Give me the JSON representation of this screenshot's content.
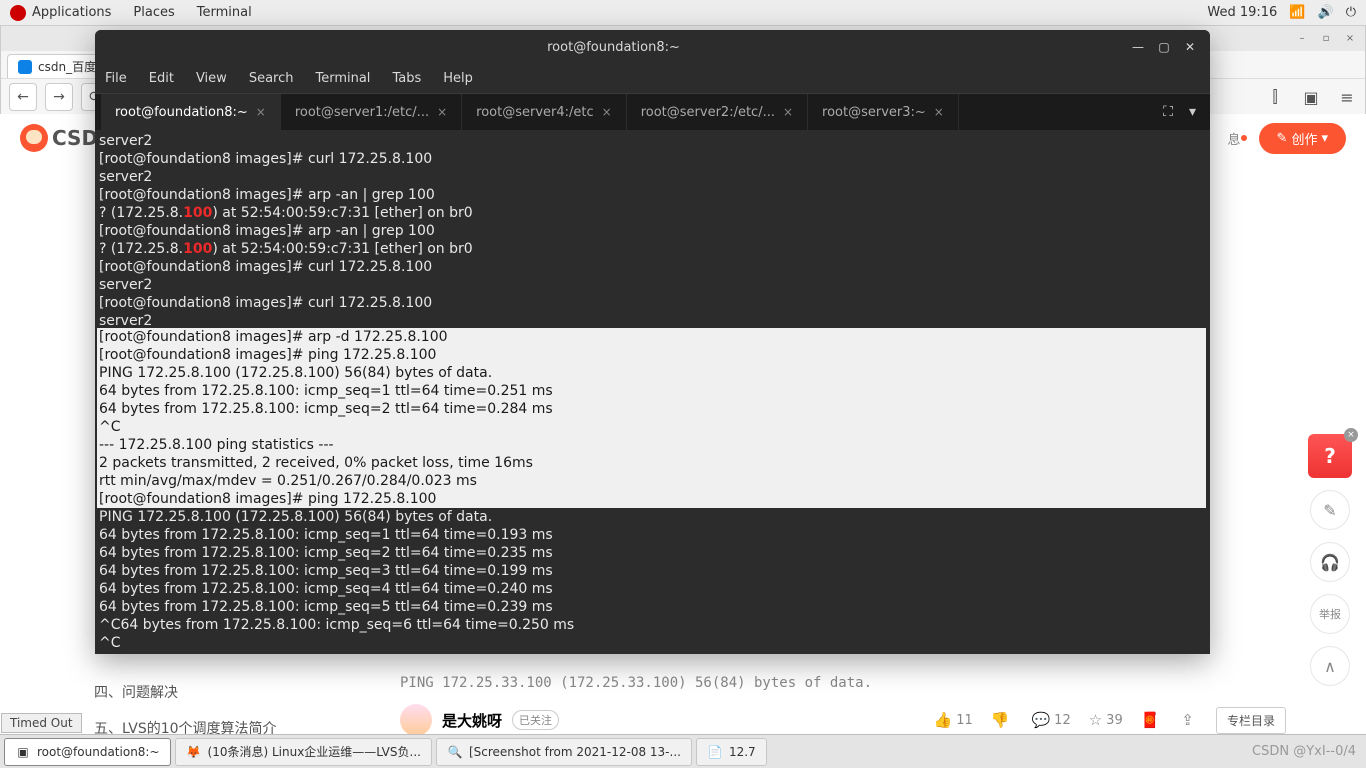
{
  "gnome": {
    "apps": "Applications",
    "places": "Places",
    "terminal": "Terminal",
    "clock": "Wed 19:16"
  },
  "browser": {
    "tab_title": "csdn_百度",
    "min": "–",
    "max": "▫",
    "close": "×",
    "toolbar_icons": {
      "back": "←",
      "fwd": "→",
      "reload": "⟳",
      "library": "⫿",
      "sidebar": "▣",
      "menu": "≡"
    }
  },
  "csdn": {
    "logo_text": "CSDI",
    "msg_indicator": "息",
    "create_label": "创作",
    "side_items": [
      "四、问题解决",
      "五、LVS的10个调度算法简介"
    ],
    "peek_text": "PING 172.25.33.100 (172.25.33.100) 56(84) bytes of data.",
    "author_name": "是大姚呀",
    "follow_label": "已关注",
    "stats": {
      "like": "11",
      "comments": "12",
      "star": "39"
    },
    "column_btn": "专栏目录",
    "rail": {
      "report": "举报"
    }
  },
  "terminal": {
    "title": "root@foundation8:~",
    "menu": [
      "File",
      "Edit",
      "View",
      "Search",
      "Terminal",
      "Tabs",
      "Help"
    ],
    "tabs": [
      {
        "label": "root@foundation8:~",
        "active": true
      },
      {
        "label": "root@server1:/etc/..."
      },
      {
        "label": "root@server4:/etc"
      },
      {
        "label": "root@server2:/etc/..."
      },
      {
        "label": "root@server3:~"
      }
    ],
    "lines_top": [
      "server2",
      "[root@foundation8 images]# curl 172.25.8.100",
      "server2",
      "[root@foundation8 images]# arp -an | grep 100",
      {
        "pre": "? (172.25.8.",
        "hi": "100",
        "post": ") at 52:54:00:59:c7:31 [ether] on br0"
      },
      "[root@foundation8 images]# arp -an | grep 100",
      {
        "pre": "? (172.25.8.",
        "hi": "100",
        "post": ") at 52:54:00:59:c7:31 [ether] on br0"
      },
      "[root@foundation8 images]# curl 172.25.8.100",
      "server2",
      "[root@foundation8 images]# curl 172.25.8.100",
      "server2"
    ],
    "lines_highlight": [
      "[root@foundation8 images]# arp -d 172.25.8.100",
      "[root@foundation8 images]# ping 172.25.8.100",
      "PING 172.25.8.100 (172.25.8.100) 56(84) bytes of data.",
      "64 bytes from 172.25.8.100: icmp_seq=1 ttl=64 time=0.251 ms",
      "64 bytes from 172.25.8.100: icmp_seq=2 ttl=64 time=0.284 ms",
      "^C",
      "--- 172.25.8.100 ping statistics ---",
      "2 packets transmitted, 2 received, 0% packet loss, time 16ms",
      "rtt min/avg/max/mdev = 0.251/0.267/0.284/0.023 ms",
      "[root@foundation8 images]# ping 172.25.8.100"
    ],
    "lines_bottom": [
      "PING 172.25.8.100 (172.25.8.100) 56(84) bytes of data.",
      "64 bytes from 172.25.8.100: icmp_seq=1 ttl=64 time=0.193 ms",
      "64 bytes from 172.25.8.100: icmp_seq=2 ttl=64 time=0.235 ms",
      "64 bytes from 172.25.8.100: icmp_seq=3 ttl=64 time=0.199 ms",
      "64 bytes from 172.25.8.100: icmp_seq=4 ttl=64 time=0.240 ms",
      "64 bytes from 172.25.8.100: icmp_seq=5 ttl=64 time=0.239 ms",
      "^C64 bytes from 172.25.8.100: icmp_seq=6 ttl=64 time=0.250 ms",
      "^C"
    ]
  },
  "status": {
    "timed_out": "Timed Out"
  },
  "panel": {
    "tasks": [
      {
        "icon": "▣",
        "label": "root@foundation8:~",
        "active": true
      },
      {
        "icon": "🦊",
        "label": "(10条消息) Linux企业运维——LVS负..."
      },
      {
        "icon": "🔍",
        "label": "[Screenshot from 2021-12-08 13-..."
      },
      {
        "icon": "📄",
        "label": "12.7"
      }
    ],
    "watermark": "CSDN @YxI--0/4"
  }
}
